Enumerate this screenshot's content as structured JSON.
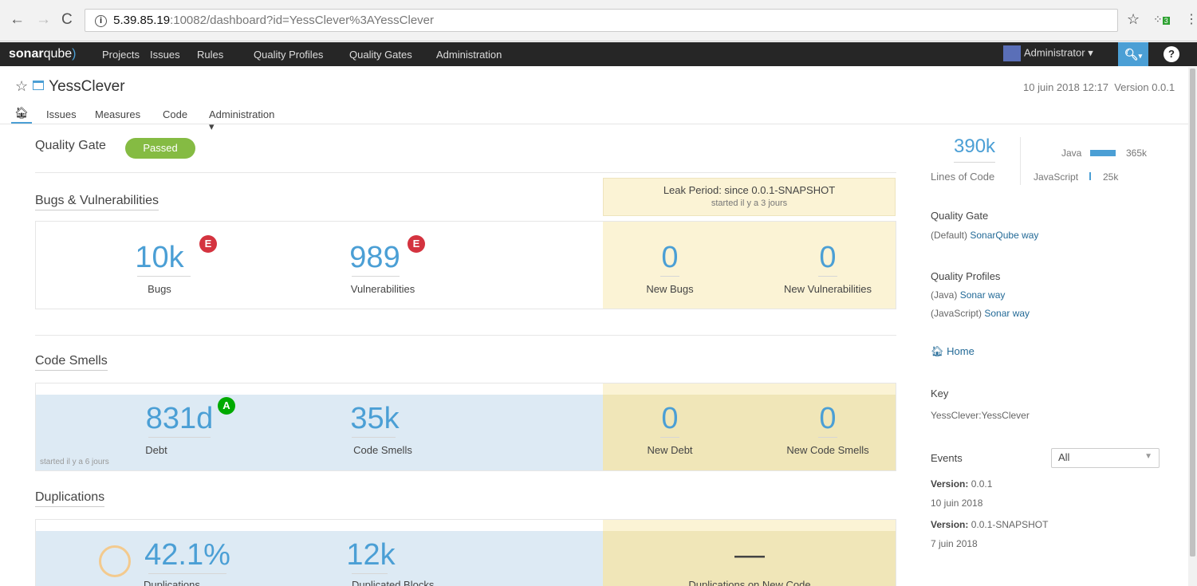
{
  "browser": {
    "url_host": "5.39.85.19",
    "url_rest": ":10082/dashboard?id=YessClever%3AYessClever",
    "extension_badge": "3"
  },
  "nav": {
    "logo_bold": "sonar",
    "logo_rest": "qube",
    "items": [
      "Projects",
      "Issues",
      "Rules",
      "Quality Profiles",
      "Quality Gates",
      "Administration"
    ],
    "user": "Administrator",
    "help": "?"
  },
  "project": {
    "name": "YessClever",
    "date": "10 juin 2018 12:17",
    "version": "Version 0.0.1",
    "tabs": [
      "Issues",
      "Measures",
      "Code",
      "Administration"
    ]
  },
  "quality_gate": {
    "label": "Quality Gate",
    "status": "Passed"
  },
  "leak": {
    "title": "Leak Period: since 0.0.1-SNAPSHOT",
    "subtitle": "started il y a 3 jours"
  },
  "bugs_vulns": {
    "title": "Bugs & Vulnerabilities",
    "bugs": {
      "value": "10k",
      "label": "Bugs",
      "rating": "E"
    },
    "vulns": {
      "value": "989",
      "label": "Vulnerabilities",
      "rating": "E"
    },
    "new_bugs": {
      "value": "0",
      "label": "New Bugs"
    },
    "new_vulns": {
      "value": "0",
      "label": "New Vulnerabilities"
    }
  },
  "code_smells": {
    "title": "Code Smells",
    "debt": {
      "value": "831d",
      "label": "Debt",
      "rating": "A"
    },
    "smells": {
      "value": "35k",
      "label": "Code Smells"
    },
    "new_debt": {
      "value": "0",
      "label": "New Debt"
    },
    "new_smells": {
      "value": "0",
      "label": "New Code Smells"
    },
    "started": "started il y a 6 jours"
  },
  "duplications": {
    "title": "Duplications",
    "dup": {
      "value": "42.1%",
      "label": "Duplications"
    },
    "blocks": {
      "value": "12k",
      "label": "Duplicated Blocks"
    },
    "new_dup": {
      "value": "—",
      "label": "Duplications on New Code"
    }
  },
  "sidebar": {
    "loc": "390k",
    "loc_label": "Lines of Code",
    "languages": [
      {
        "name": "Java",
        "value": "365k",
        "fraction": 0.936
      },
      {
        "name": "JavaScript",
        "value": "25k",
        "fraction": 0.064
      }
    ],
    "qg_title": "Quality Gate",
    "qg_default": "(Default)",
    "qg_link": "SonarQube way",
    "qp_title": "Quality Profiles",
    "qp": [
      {
        "lang": "(Java)",
        "link": "Sonar way"
      },
      {
        "lang": "(JavaScript)",
        "link": "Sonar way"
      }
    ],
    "home": "Home",
    "key_title": "Key",
    "key": "YessClever:YessClever",
    "events_title": "Events",
    "events_filter": "All",
    "events": [
      {
        "label": "Version:",
        "version": "0.0.1",
        "date": "10 juin 2018"
      },
      {
        "label": "Version:",
        "version": "0.0.1-SNAPSHOT",
        "date": "7 juin 2018"
      }
    ]
  },
  "colors": {
    "accent": "#4b9fd5",
    "passed": "#85bb43",
    "rating_e": "#d4333f",
    "rating_a": "#00aa00",
    "leak_bg": "#fbf3d5"
  }
}
